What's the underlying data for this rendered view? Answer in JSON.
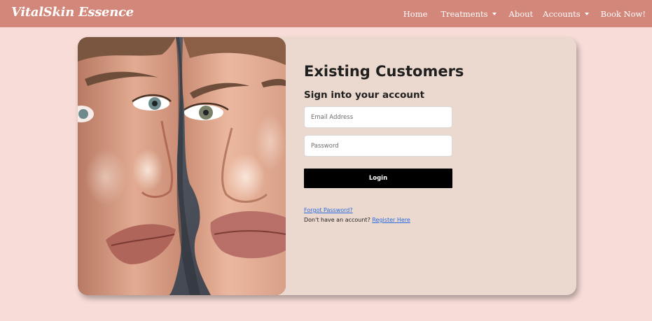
{
  "navbar": {
    "brand": "VitalSkin Essence",
    "links": [
      {
        "label": "Home",
        "dropdown": false
      },
      {
        "label": "Treatments",
        "dropdown": true
      },
      {
        "label": "About",
        "dropdown": false
      },
      {
        "label": "Accounts",
        "dropdown": true
      },
      {
        "label": "Book Now!",
        "dropdown": false
      }
    ],
    "background_color": "#d3877a"
  },
  "login": {
    "title": "Existing Customers",
    "subtitle": "Sign into your account",
    "email_placeholder": "Email Address",
    "password_placeholder": "Password",
    "login_label": "Login",
    "forgot_label": "Forgot Password?",
    "register_prompt": "Don't have an account?",
    "register_label": "Register Here",
    "card_color": "#ebd8ce"
  },
  "photo": {
    "subject": "two-faces-closeup-photo"
  },
  "colors": {
    "page_background": "#f8dcd8",
    "link": "#2a6be0",
    "button": "#000000"
  }
}
